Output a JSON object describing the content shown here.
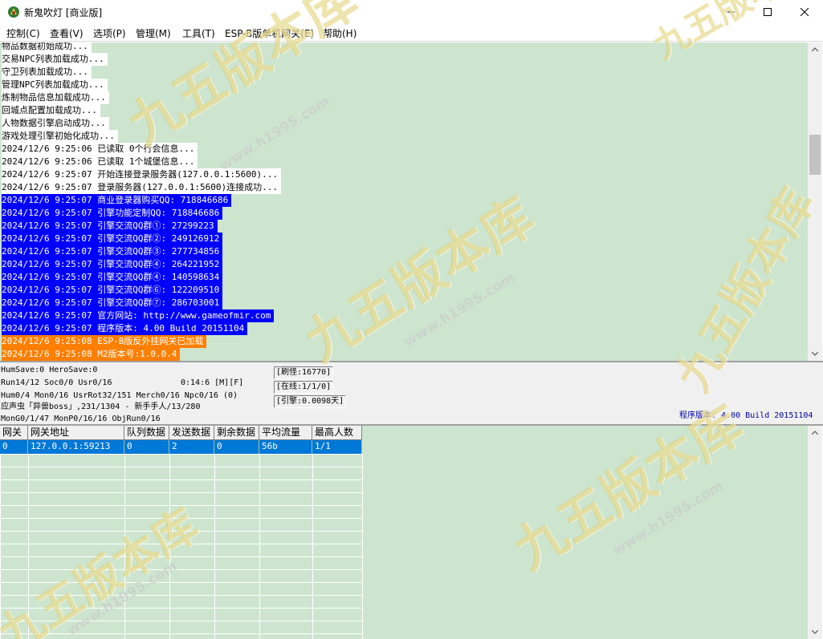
{
  "window": {
    "title": "新鬼吹灯 [商业版]",
    "minimize_label": "—",
    "maximize_label": "☐",
    "close_label": "✕",
    "icon": "game-logo-icon"
  },
  "menu": [
    "控制(C)",
    "查看(V)",
    "选项(P)",
    "管理(M)",
    "工具(T)",
    "ESP-B版单机网关(E)",
    "帮助(H)"
  ],
  "log": [
    {
      "text": "物品数据初始成功...",
      "style": "white"
    },
    {
      "text": "交易NPC列表加载成功...",
      "style": "white"
    },
    {
      "text": "守卫列表加载成功...",
      "style": "white"
    },
    {
      "text": "管理NPC列表加载成功...",
      "style": "white"
    },
    {
      "text": "炼制物品信息加载成功...",
      "style": "white"
    },
    {
      "text": "回城点配置加载成功...",
      "style": "white"
    },
    {
      "text": "人物数据引擎启动成功...",
      "style": "white"
    },
    {
      "text": "游戏处理引擎初始化成功...",
      "style": "white"
    },
    {
      "text": "2024/12/6 9:25:06 已读取 0个行会信息...",
      "style": "white"
    },
    {
      "text": "2024/12/6 9:25:06 已读取 1个城堡信息...",
      "style": "white"
    },
    {
      "text": "2024/12/6 9:25:07 开始连接登录服务器(127.0.0.1:5600)...",
      "style": "white"
    },
    {
      "text": "2024/12/6 9:25:07 登录服务器(127.0.0.1:5600)连接成功...",
      "style": "white"
    },
    {
      "text": "2024/12/6 9:25:07 商业登录器购买QQ: 718846686",
      "style": "blue"
    },
    {
      "text": "2024/12/6 9:25:07 引擎功能定制QQ: 718846686",
      "style": "blue"
    },
    {
      "text": "2024/12/6 9:25:07 引擎交流QQ群①: 27299223",
      "style": "blue"
    },
    {
      "text": "2024/12/6 9:25:07 引擎交流QQ群②: 249126912",
      "style": "blue"
    },
    {
      "text": "2024/12/6 9:25:07 引擎交流QQ群③: 277734856",
      "style": "blue"
    },
    {
      "text": "2024/12/6 9:25:07 引擎交流QQ群④: 264221952",
      "style": "blue"
    },
    {
      "text": "2024/12/6 9:25:07 引擎交流QQ群④: 140598634",
      "style": "blue"
    },
    {
      "text": "2024/12/6 9:25:07 引擎交流QQ群⑥: 122209510",
      "style": "blue"
    },
    {
      "text": "2024/12/6 9:25:07 引擎交流QQ群⑦: 286703001",
      "style": "blue"
    },
    {
      "text": "2024/12/6 9:25:07 官方网站: http://www.gameofmir.com",
      "style": "blue"
    },
    {
      "text": "2024/12/6 9:25:07 程序版本: 4.00 Build 20151104",
      "style": "blue"
    },
    {
      "text": "2024/12/6 9:25:08 ESP-B版反外挂网关已加载",
      "style": "orange"
    },
    {
      "text": "2024/12/6 9:25:08 M2版本号:1.0.0.4",
      "style": "orange"
    }
  ],
  "status": {
    "line1": "HumSave:0 HeroSave:0",
    "line2": "Run14/12 Soc0/0 Usr0/16",
    "time": "0:14:6 [M][F]",
    "line3": "Hum0/4 Mon0/16 UsrRot32/151 Merch0/16 Npc0/16 (0)",
    "line4": "应声虫「异兽boss」,231/1304 - 新手手人/13/280",
    "line5": "MonG0/1/47 MonP0/16/16 ObjRun0/16",
    "refresh_monster": "[刷怪:16770]",
    "online": "[在线:1/1/0]",
    "engine": "[引擎:0.0098天]",
    "version": "程序版本: 4.00 Build 20151104"
  },
  "gateway_table": {
    "columns": [
      "网关",
      "网关地址",
      "队列数据",
      "发送数据",
      "剩余数据",
      "平均流量",
      "最高人数"
    ],
    "rows": [
      [
        "0",
        "127.0.0.1:59213",
        "0",
        "2",
        "0",
        "56b",
        "1/1"
      ]
    ]
  },
  "watermark": {
    "text": "九五版本库",
    "url": "www.h1995.com"
  },
  "colors": {
    "panel_bg": "#cde5cf",
    "log_blue": "#0000ff",
    "log_orange": "#ff7f00",
    "selected_row": "#0078d7"
  }
}
